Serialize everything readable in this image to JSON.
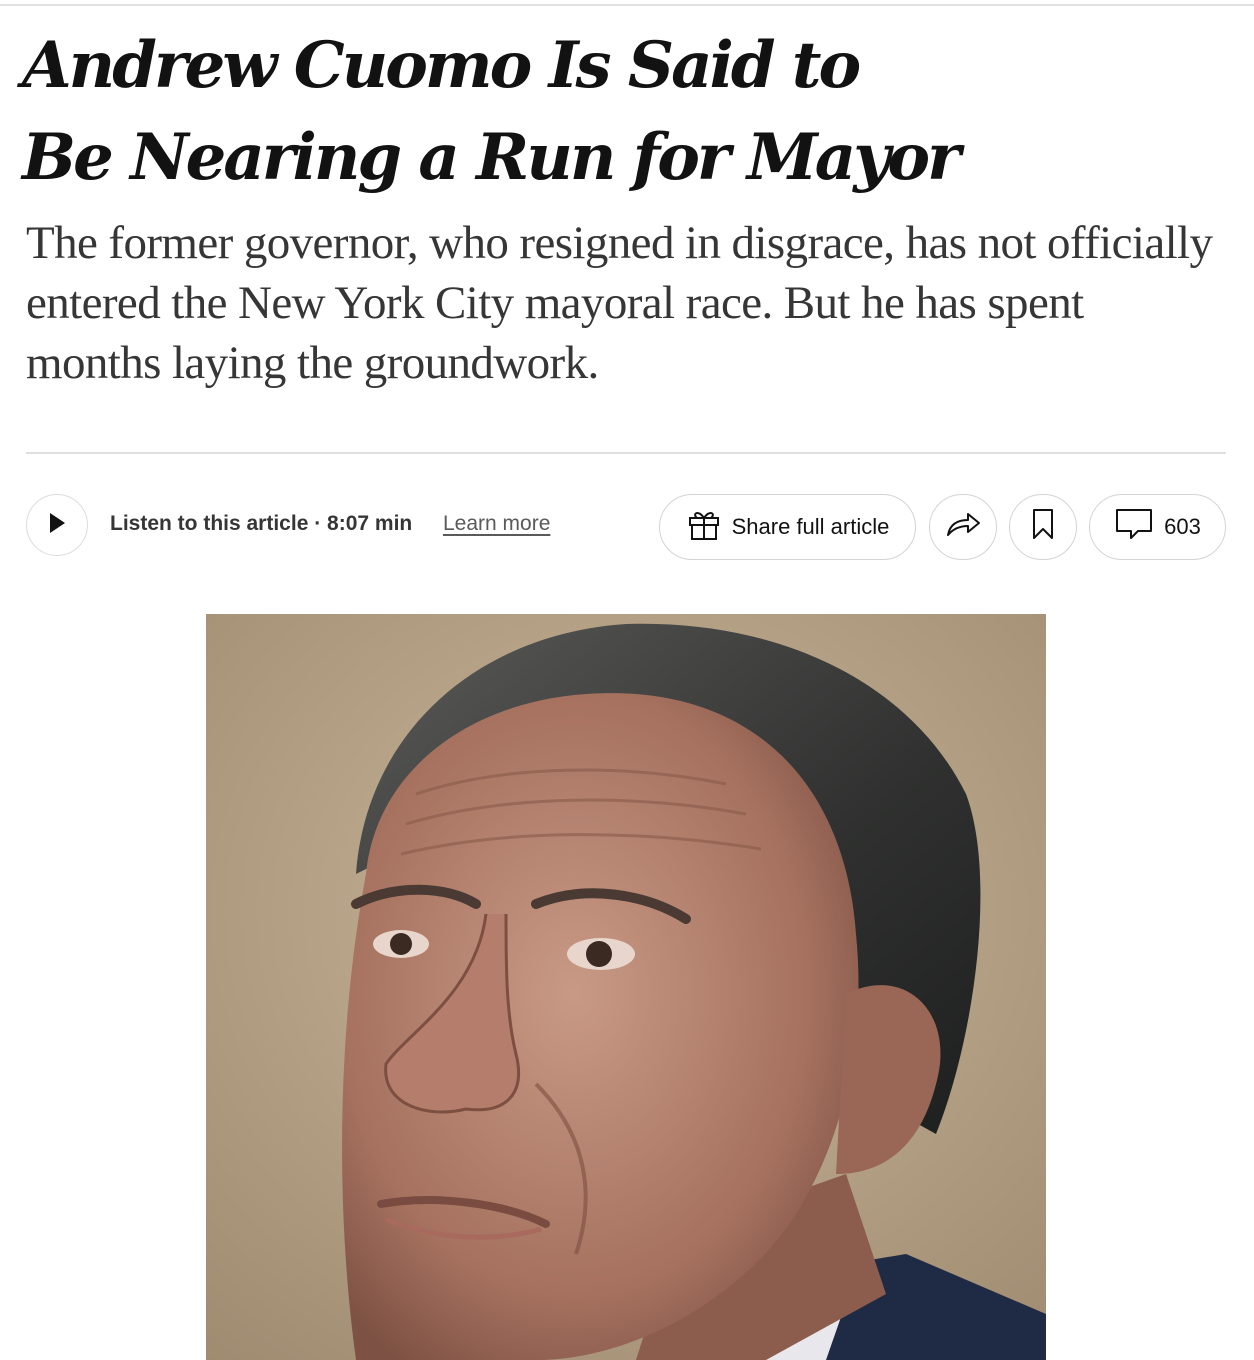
{
  "article": {
    "headline_line1": "Andrew Cuomo Is Said to",
    "headline_line2": "Be Nearing a Run for Mayor",
    "summary": "The former governor, who resigned in disgrace, has not officially entered the New York City mayoral race. But he has spent months laying the groundwork."
  },
  "toolbar": {
    "listen_label": "Listen to this article · 8:07 min",
    "learn_more": "Learn more",
    "share_label": "Share full article",
    "comment_count": "603",
    "icons": {
      "play": "play-icon",
      "gift": "gift-icon",
      "share": "forward-arrow-icon",
      "bookmark": "bookmark-icon",
      "comments": "comment-bubble-icon"
    }
  },
  "colors": {
    "text": "#121212",
    "summary_text": "#363636",
    "border": "#d4d4d4",
    "photo_background": "#b8a58a"
  }
}
